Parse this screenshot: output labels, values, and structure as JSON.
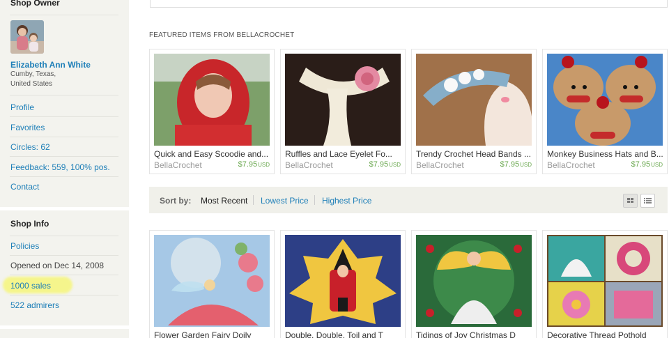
{
  "sidebar": {
    "owner": {
      "heading": "Shop Owner",
      "name": "Elizabeth Ann White",
      "location_line1": "Cumby, Texas,",
      "location_line2": "United States",
      "links": {
        "profile": "Profile",
        "favorites": "Favorites",
        "circles": "Circles: 62",
        "feedback": "Feedback: 559, 100% pos.",
        "contact": "Contact"
      }
    },
    "info": {
      "heading": "Shop Info",
      "policies": "Policies",
      "opened": "Opened on Dec 14, 2008",
      "sales": "1000 sales",
      "admirers": "522 admirers"
    }
  },
  "featured": {
    "heading": "FEATURED ITEMS FROM BELLACROCHET",
    "items": [
      {
        "title": "Quick and Easy Scoodie and...",
        "shop": "BellaCrochet",
        "price": "$7.95",
        "currency": "USD"
      },
      {
        "title": "Ruffles and Lace Eyelet Fo...",
        "shop": "BellaCrochet",
        "price": "$7.95",
        "currency": "USD"
      },
      {
        "title": "Trendy Crochet Head Bands ...",
        "shop": "BellaCrochet",
        "price": "$7.95",
        "currency": "USD"
      },
      {
        "title": "Monkey Business Hats and B...",
        "shop": "BellaCrochet",
        "price": "$7.95",
        "currency": "USD"
      }
    ]
  },
  "sort": {
    "label": "Sort by:",
    "options": [
      "Most Recent",
      "Lowest Price",
      "Highest Price"
    ],
    "selected": "Most Recent"
  },
  "listing": {
    "items": [
      {
        "title": "Flower Garden Fairy Doily"
      },
      {
        "title": "Double, Double, Toil and T"
      },
      {
        "title": "Tidings of Joy Christmas D"
      },
      {
        "title": "Decorative Thread Pothold"
      }
    ]
  },
  "colors": {
    "link": "#1e7fb8",
    "price": "#6aa84f",
    "sidebar_bg": "#f3f3ee",
    "sales_highlight": "#f5f58c"
  },
  "icons": [
    "grid-view-icon",
    "list-view-icon"
  ]
}
